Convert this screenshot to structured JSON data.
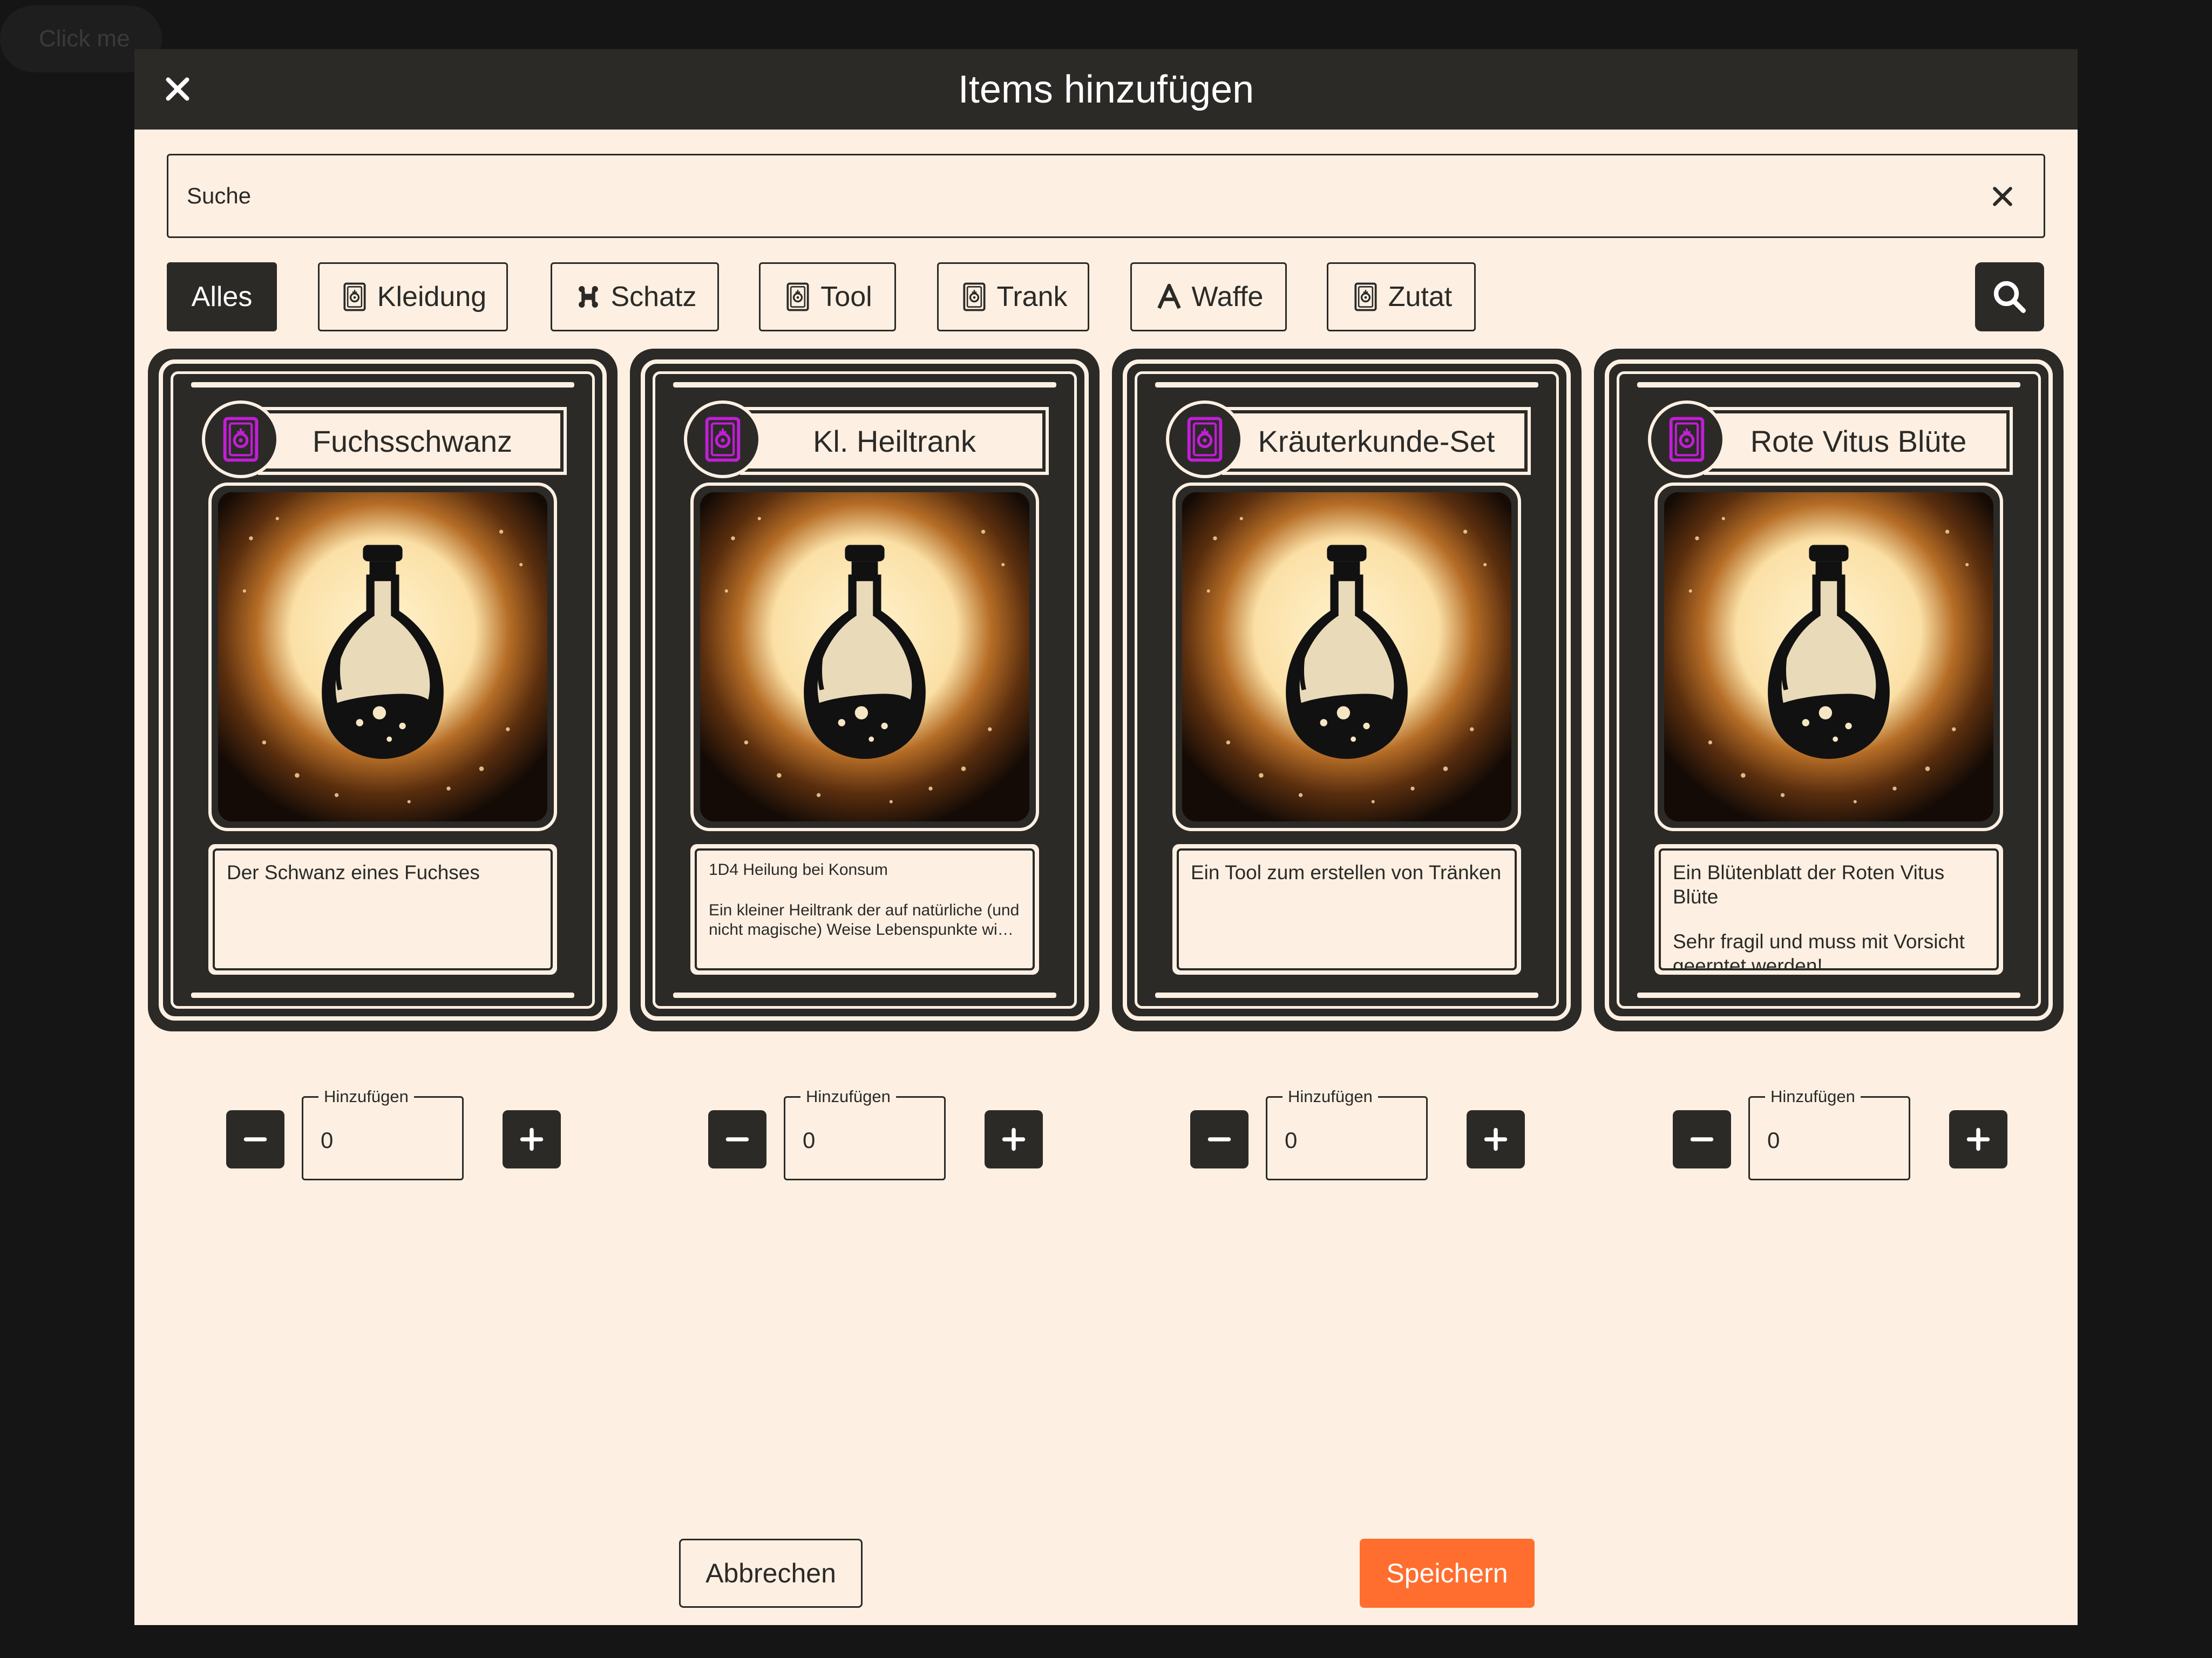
{
  "background_button": {
    "label": "Click me"
  },
  "dialog": {
    "title": "Items hinzufügen",
    "close_icon": "close-icon"
  },
  "search": {
    "placeholder": "Suche",
    "value": "",
    "clear_icon": "close-icon"
  },
  "filters": [
    {
      "label": "Alles",
      "icon": null,
      "active": true
    },
    {
      "label": "Kleidung",
      "icon": "card-rune-icon",
      "active": false
    },
    {
      "label": "Schatz",
      "icon": "bone-icon",
      "active": false
    },
    {
      "label": "Tool",
      "icon": "card-rune-icon",
      "active": false
    },
    {
      "label": "Trank",
      "icon": "card-rune-icon",
      "active": false
    },
    {
      "label": "Waffe",
      "icon": "letter-a-icon",
      "active": false
    },
    {
      "label": "Zutat",
      "icon": "card-rune-icon",
      "active": false
    }
  ],
  "search_button_icon": "search-icon",
  "items": [
    {
      "name": "Fuchsschwanz",
      "badge_icon": "card-rune-icon",
      "image": "potion-bottle-icon",
      "description": [
        "Der Schwanz eines Fuchses"
      ],
      "quantity_label": "Hinzufügen",
      "quantity": "0"
    },
    {
      "name": "Kl. Heiltrank",
      "badge_icon": "card-rune-icon",
      "image": "potion-bottle-icon",
      "description": [
        "1D4 Heilung bei Konsum",
        "Ein kleiner Heiltrank der auf natürliche (und",
        "nicht magische) Weise Lebenspunkte wiederherstellt"
      ],
      "quantity_label": "Hinzufügen",
      "quantity": "0"
    },
    {
      "name": "Kräuterkunde-Set",
      "badge_icon": "card-rune-icon",
      "image": "potion-bottle-icon",
      "description": [
        "Ein Tool zum erstellen von Tränken"
      ],
      "quantity_label": "Hinzufügen",
      "quantity": "0"
    },
    {
      "name": "Rote Vitus Blüte",
      "badge_icon": "card-rune-icon",
      "image": "potion-bottle-icon",
      "description": [
        "Ein Blütenblatt der Roten Vitus Blüte",
        "Sehr fragil und muss mit Vorsicht",
        "geerntet werden!"
      ],
      "quantity_label": "Hinzufügen",
      "quantity": "0"
    }
  ],
  "actions": {
    "cancel_label": "Abbrechen",
    "save_label": "Speichern"
  },
  "colors": {
    "dark": "#2b2a27",
    "paper": "#fdf0e3",
    "accent": "#ff6e2f",
    "rune": "#c21ed6"
  }
}
